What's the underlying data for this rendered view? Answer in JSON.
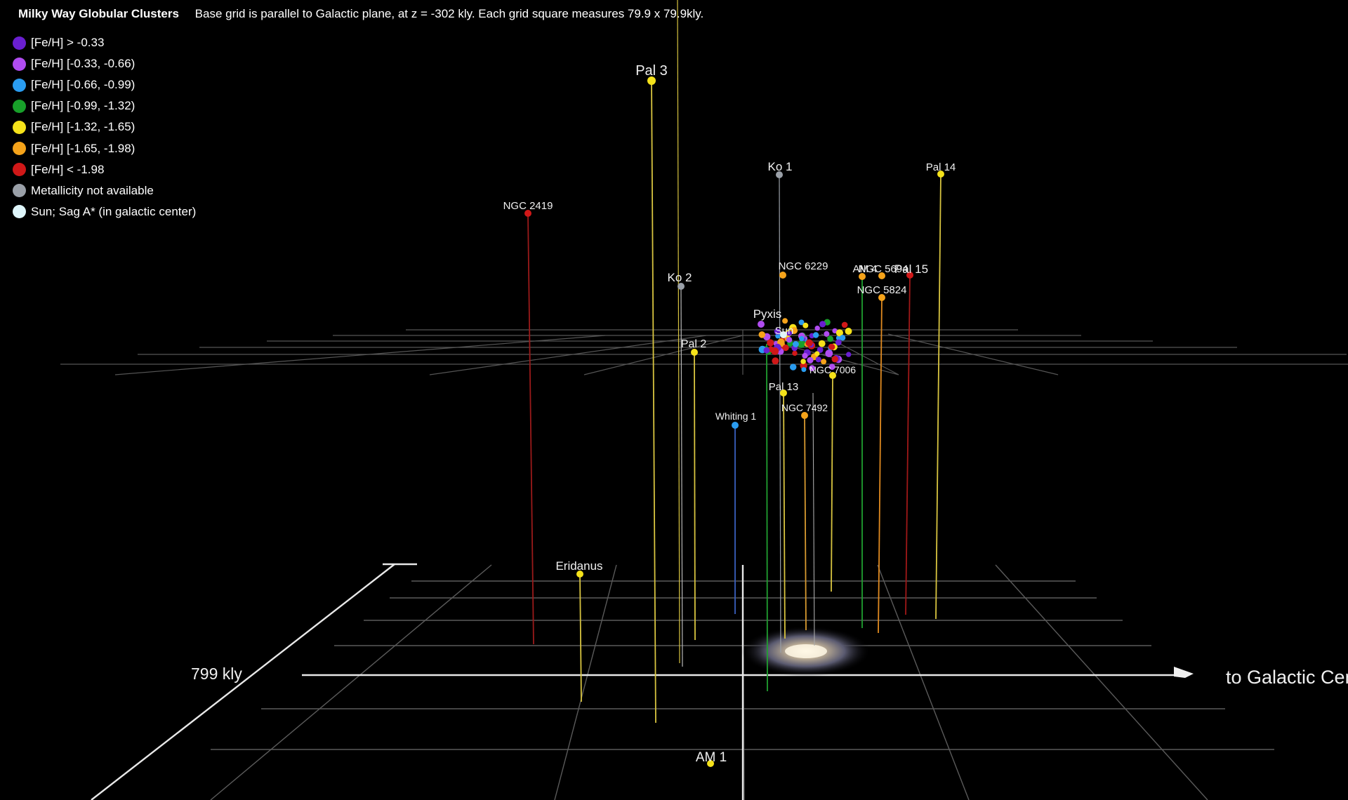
{
  "header": {
    "title": "Milky Way Globular Clusters",
    "subtitle": "Base grid is parallel to Galactic plane, at z = -302 kly. Each grid square measures 79.9 x 79.9kly."
  },
  "legend": [
    {
      "label": "[Fe/H] > -0.33",
      "color": "#6a1fd0"
    },
    {
      "label": "[Fe/H] [-0.33, -0.66)",
      "color": "#b04cf0"
    },
    {
      "label": "[Fe/H] [-0.66, -0.99)",
      "color": "#2a9cf0"
    },
    {
      "label": "[Fe/H] [-0.99, -1.32)",
      "color": "#18a02a"
    },
    {
      "label": "[Fe/H] [-1.32, -1.65)",
      "color": "#f5e21a"
    },
    {
      "label": "[Fe/H] [-1.65, -1.98)",
      "color": "#f5a31a"
    },
    {
      "label": "[Fe/H] < -1.98",
      "color": "#d01818"
    },
    {
      "label": "Metallicity not available",
      "color": "#9aa0a8"
    },
    {
      "label": "Sun; Sag A* (in galactic center)",
      "color": "#dff6fb"
    }
  ],
  "axes": {
    "scale_label": "799 kly",
    "direction_label": "to Galactic Center"
  },
  "clusters": [
    {
      "name": "Pal 3",
      "color": "#f5e21a"
    },
    {
      "name": "Ko 1",
      "color": "#9aa0a8"
    },
    {
      "name": "Pal 14",
      "color": "#f5e21a"
    },
    {
      "name": "NGC 2419",
      "color": "#d01818"
    },
    {
      "name": "Ko 2",
      "color": "#9aa0a8"
    },
    {
      "name": "NGC 6229",
      "color": "#f5a31a"
    },
    {
      "name": "AM 4",
      "color": "#f5a31a"
    },
    {
      "name": "NGC 5694",
      "color": "#f5a31a"
    },
    {
      "name": "Pal 15",
      "color": "#d01818"
    },
    {
      "name": "NGC 5824",
      "color": "#f5a31a"
    },
    {
      "name": "Pyxis",
      "color": "#b04cf0"
    },
    {
      "name": "Sun",
      "color": "#dff6fb"
    },
    {
      "name": "Pal 2",
      "color": "#f5e21a"
    },
    {
      "name": "NGC 7006",
      "color": "#f5e21a"
    },
    {
      "name": "Pal 13",
      "color": "#f5e21a"
    },
    {
      "name": "NGC 7492",
      "color": "#f5a31a"
    },
    {
      "name": "Whiting 1",
      "color": "#2a9cf0"
    },
    {
      "name": "Eridanus",
      "color": "#f5e21a"
    },
    {
      "name": "AM 1",
      "color": "#f5e21a"
    }
  ]
}
